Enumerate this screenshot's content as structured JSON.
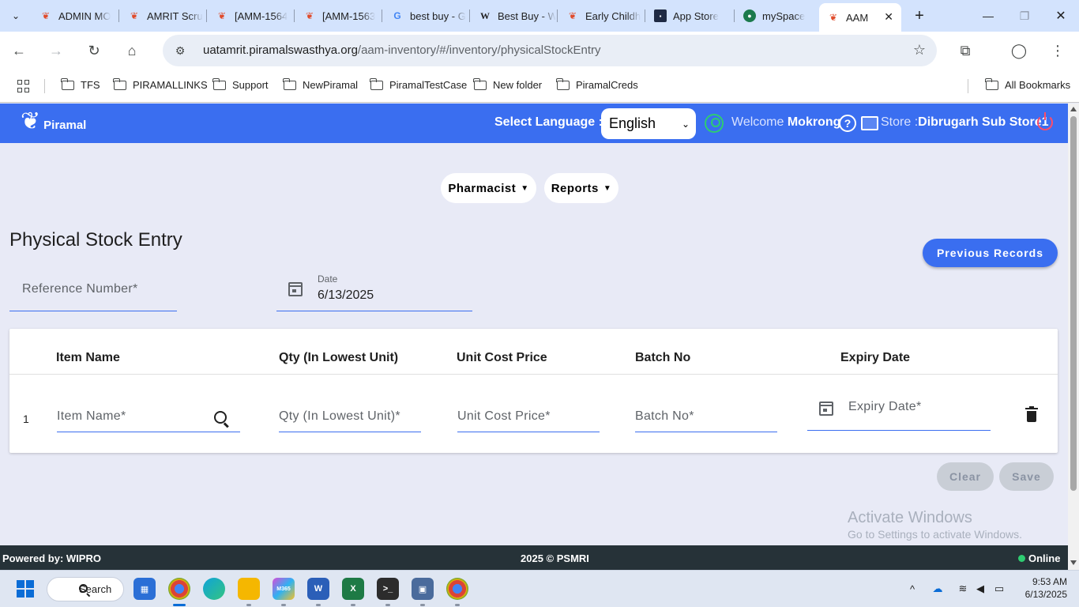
{
  "browser": {
    "tabs": [
      {
        "title": "ADMIN MO",
        "favicon": "piramal-icon"
      },
      {
        "title": "AMRIT Scru",
        "favicon": "piramal-icon"
      },
      {
        "title": "[AMM-1564",
        "favicon": "piramal-icon"
      },
      {
        "title": "[AMM-1563",
        "favicon": "piramal-icon"
      },
      {
        "title": "best buy - G",
        "favicon": "google-icon"
      },
      {
        "title": "Best Buy - W",
        "favicon": "wikipedia-icon"
      },
      {
        "title": "Early Childh",
        "favicon": "piramal-icon"
      },
      {
        "title": "App Store",
        "favicon": "appstore-icon"
      },
      {
        "title": "mySpace",
        "favicon": "myspace-icon"
      },
      {
        "title": "AAM",
        "favicon": "piramal-icon",
        "active": true
      }
    ],
    "url_host": "uatamrit.piramalswasthya.org",
    "url_path": "/aam-inventory/#/inventory/physicalStockEntry",
    "bookmarks": [
      "TFS",
      "PIRAMALLINKS",
      "Support",
      "NewPiramal",
      "PiramalTestCase",
      "New folder",
      "PiramalCreds"
    ],
    "all_bookmarks": "All Bookmarks"
  },
  "header": {
    "logo_text": "Piramal",
    "select_language_label": "Select Language :",
    "language_value": "English",
    "welcome_prefix": "Welcome",
    "user_name": "Mokrong",
    "store_prefix": "Store :",
    "store_name": "Dibrugarh Sub Store1"
  },
  "nav": {
    "pharmacist": "Pharmacist",
    "reports": "Reports"
  },
  "page": {
    "title": "Physical Stock Entry",
    "previous_records": "Previous Records",
    "reference_placeholder": "Reference Number*",
    "date_label": "Date",
    "date_value": "6/13/2025"
  },
  "table": {
    "headers": [
      "Item Name",
      "Qty (In Lowest Unit)",
      "Unit Cost Price",
      "Batch No",
      "Expiry Date"
    ],
    "rows": [
      {
        "index": "1",
        "item_name_ph": "Item Name*",
        "qty_ph": "Qty (In Lowest Unit)*",
        "cost_ph": "Unit Cost Price*",
        "batch_ph": "Batch No*",
        "expiry_ph": "Expiry Date*"
      }
    ]
  },
  "actions": {
    "clear": "Clear",
    "save": "Save"
  },
  "watermark": {
    "line1": "Activate Windows",
    "line2": "Go to Settings to activate Windows."
  },
  "footer": {
    "left": "Powered by: WIPRO",
    "center": "2025 © PSMRI",
    "status": "Online"
  },
  "taskbar": {
    "search": "Search",
    "time": "9:53 AM",
    "date": "6/13/2025"
  },
  "colors": {
    "brand_blue": "#3a6ef0",
    "page_bg": "#e8eaf6",
    "footer_bg": "#263238",
    "online_green": "#2ecc71"
  }
}
